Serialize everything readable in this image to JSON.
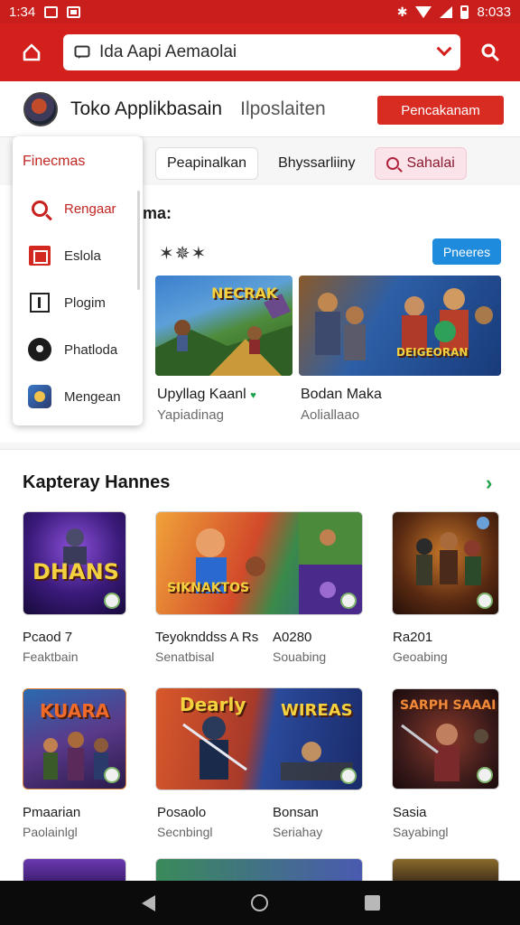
{
  "status_bar": {
    "time": "1:34",
    "battery_text": "8:033"
  },
  "app_bar": {
    "search_text": "Ida Aapi Aemaolai",
    "icons": [
      "home-icon",
      "search-icon",
      "chevron-down-icon"
    ]
  },
  "store_header": {
    "title": "Toko Applikbasain",
    "subtitle": "Ilposlaiten",
    "cta_label": "Pencakanam"
  },
  "tabs": [
    {
      "label": "Peapinalkan"
    },
    {
      "label": "Bhyssarliiny"
    },
    {
      "label": "Sahalai"
    }
  ],
  "drawer": {
    "title": "Finecmas",
    "items": [
      {
        "label": "Rengaar",
        "icon": "search-icon"
      },
      {
        "label": "Eslola",
        "icon": "photo-icon"
      },
      {
        "label": "Plogim",
        "icon": "box-icon"
      },
      {
        "label": "Phatloda",
        "icon": "dark-badge-icon"
      },
      {
        "label": "Mengean",
        "icon": "game-icon"
      }
    ]
  },
  "featured": {
    "title": "ma:",
    "rating_text": "✶✵✶",
    "more_label": "Pneeres",
    "cards": [
      {
        "art_text": "NECRAK",
        "name": "Upyllag Kaanl",
        "sub": "Yapiadinag",
        "verified": "♥"
      },
      {
        "art_text": "DEIGEORAN",
        "name": "Bodan Maka",
        "sub": "Aoliallaao"
      }
    ]
  },
  "section2": {
    "title": "Kapteray Hannes",
    "arrow": "›",
    "rows": [
      [
        {
          "art_text": "DHANS",
          "name": "Pcaod 7",
          "sub": "Feaktbain"
        },
        {
          "art_text": "SIKNAKTOS",
          "name": "Teyoknddss A Rs",
          "sub": "Senatbisal"
        },
        {
          "art_text": "",
          "name": "A0280",
          "sub": "Souabing"
        },
        {
          "art_text": "",
          "name": "Ra201",
          "sub": "Geoabing"
        }
      ],
      [
        {
          "art_text": "KUARA",
          "name": "Pmaarian",
          "sub": "Paolainlgl"
        },
        {
          "art_text": "Dearly",
          "name": "Posaolo",
          "sub": "Secnbingl"
        },
        {
          "art_text": "WIREAS",
          "name": "Bonsan",
          "sub": "Seriahay"
        },
        {
          "art_text": "SARPH SAAAI",
          "name": "Sasia",
          "sub": "Sayabingl"
        }
      ]
    ]
  },
  "colors": {
    "primary": "#d4201c",
    "accent_blue": "#1e8bdc",
    "green": "#1ca14a"
  }
}
